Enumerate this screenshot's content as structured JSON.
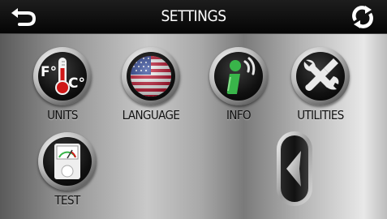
{
  "header": {
    "title": "SETTINGS",
    "back_icon": "back-arrow-icon",
    "refresh_icon": "refresh-icon"
  },
  "tiles": [
    {
      "label": "UNITS",
      "icon": "thermometer-icon"
    },
    {
      "label": "LANGUAGE",
      "icon": "flag-globe-icon"
    },
    {
      "label": "INFO",
      "icon": "info-person-icon"
    },
    {
      "label": "UTILITIES",
      "icon": "tools-icon"
    },
    {
      "label": "TEST",
      "icon": "gauge-icon"
    }
  ],
  "units_icon_text": {
    "f": "F°",
    "c": "C°"
  },
  "nav": {
    "prev_icon": "chevron-left-icon"
  },
  "colors": {
    "header_bg": "#0a0a0a",
    "thermo_red": "#d01818",
    "info_green": "#39b54a"
  }
}
